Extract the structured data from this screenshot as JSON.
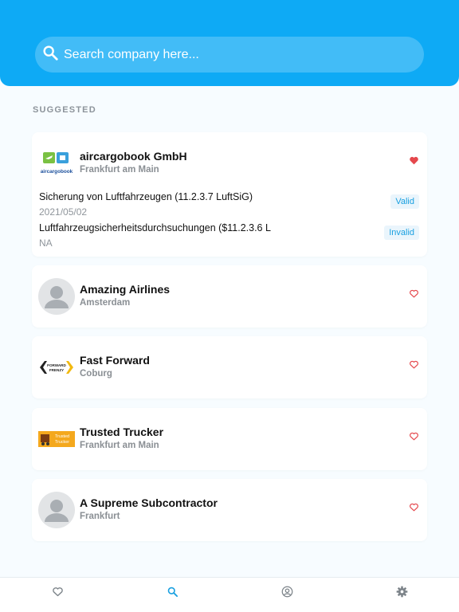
{
  "colors": {
    "header": "#0eaaf5",
    "accent": "#1aa0e0",
    "heart": "#e5484d",
    "muted": "#8a8f94"
  },
  "search": {
    "placeholder": "Search company here...",
    "icon": "search-icon"
  },
  "section": {
    "label": "SUGGESTED"
  },
  "companies": [
    {
      "name": "aircargobook GmbH",
      "city": "Frankfurt am Main",
      "logo": "aircargobook-logo",
      "logo_text": "aircargobook",
      "favorite": true,
      "certificates": [
        {
          "title": "Sicherung von Luftfahrzeugen (11.2.3.7 LuftSiG)",
          "date": "2021/05/02",
          "status": "Valid"
        },
        {
          "title": "Luftfahrzeugsicherheitsdurchsuchungen ($11.2.3.6 L",
          "date": "NA",
          "status": "Invalid"
        }
      ]
    },
    {
      "name": "Amazing Airlines",
      "city": "Amsterdam",
      "logo": "avatar-placeholder",
      "favorite": false
    },
    {
      "name": "Fast Forward",
      "city": "Coburg",
      "logo": "fast-forward-logo",
      "logo_text": "FORWARD FRENZY",
      "favorite": false
    },
    {
      "name": "Trusted Trucker",
      "city": "Frankfurt am Main",
      "logo": "trusted-trucker-logo",
      "logo_text": "Trusted Trucker",
      "favorite": false
    },
    {
      "name": "A Supreme Subcontractor",
      "city": "Frankfurt",
      "logo": "avatar-placeholder",
      "favorite": false
    }
  ],
  "tabs": [
    {
      "name": "favorites",
      "icon": "heart-icon",
      "active": false
    },
    {
      "name": "search",
      "icon": "search-icon",
      "active": true
    },
    {
      "name": "profile",
      "icon": "user-circle-icon",
      "active": false
    },
    {
      "name": "settings",
      "icon": "gear-icon",
      "active": false
    }
  ]
}
